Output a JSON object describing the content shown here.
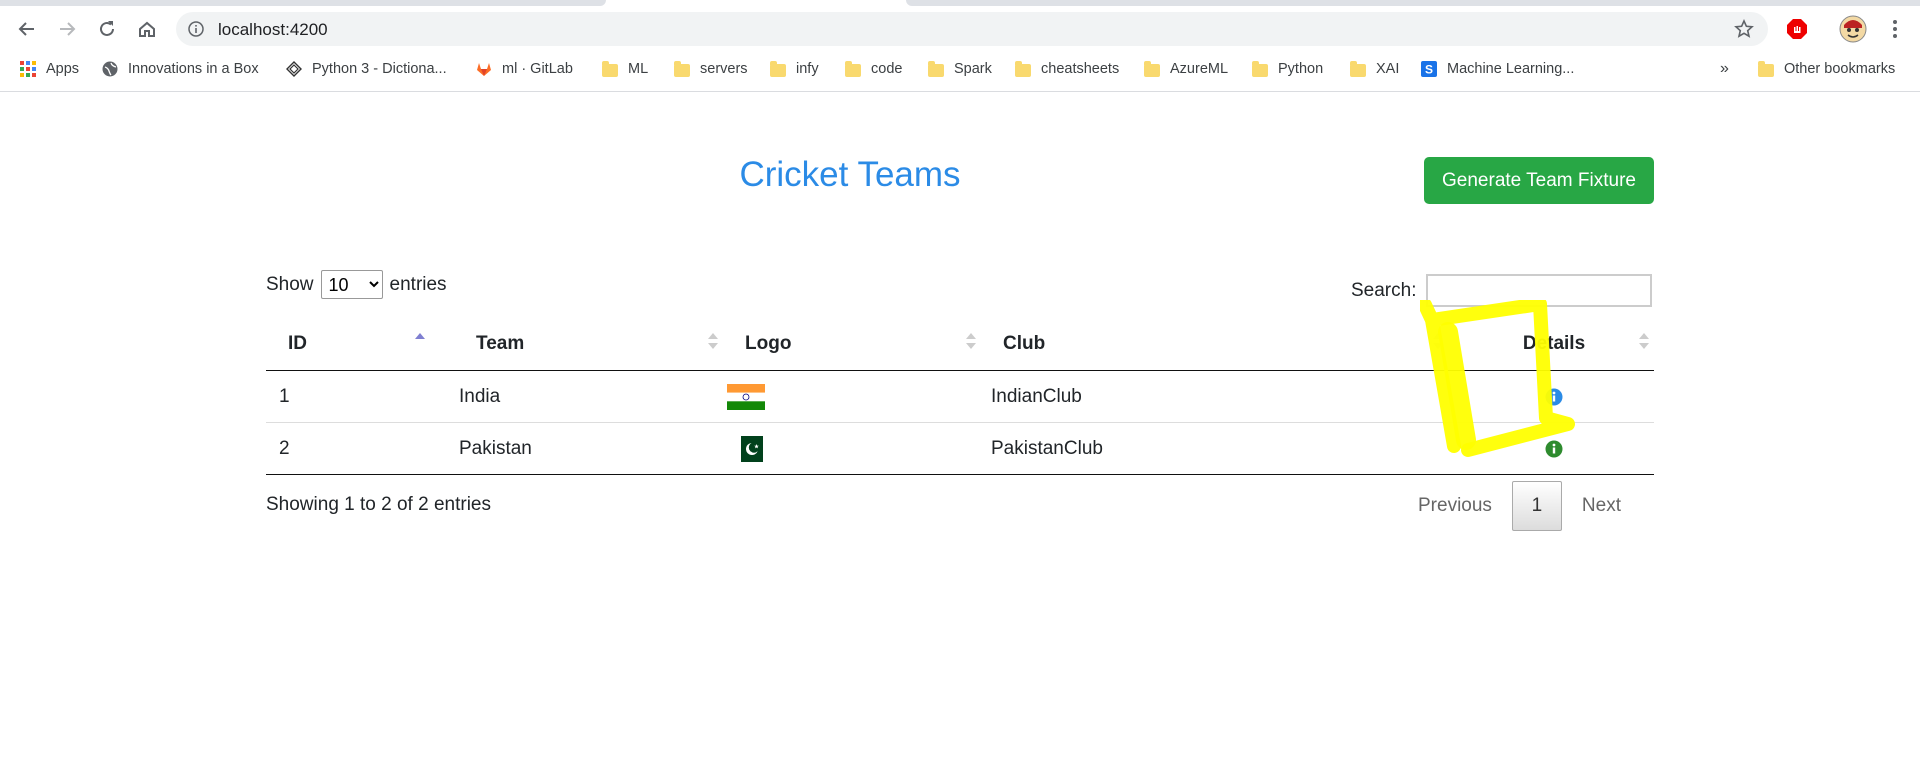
{
  "browser": {
    "url": "localhost:4200",
    "bookmarks": [
      {
        "label": "Apps",
        "icon": "apps-grid-icon"
      },
      {
        "label": "Innovations in a Box",
        "icon": "globe-icon"
      },
      {
        "label": "Python 3 - Dictiona...",
        "icon": "python-diamond-icon"
      },
      {
        "label": "ml · GitLab",
        "icon": "gitlab-icon"
      },
      {
        "label": "ML",
        "icon": "folder-icon"
      },
      {
        "label": "servers",
        "icon": "folder-icon"
      },
      {
        "label": "infy",
        "icon": "folder-icon"
      },
      {
        "label": "code",
        "icon": "folder-icon"
      },
      {
        "label": "Spark",
        "icon": "folder-icon"
      },
      {
        "label": "cheatsheets",
        "icon": "folder-icon"
      },
      {
        "label": "AzureML",
        "icon": "folder-icon"
      },
      {
        "label": "Python",
        "icon": "folder-icon"
      },
      {
        "label": "XAI",
        "icon": "folder-icon"
      },
      {
        "label": "Machine Learning...",
        "icon": "s-badge-icon"
      }
    ],
    "overflow": "»",
    "other_bookmarks": "Other bookmarks"
  },
  "page": {
    "title": "Cricket Teams",
    "generate_button": "Generate Team Fixture",
    "show_label": "Show",
    "entries_label": "entries",
    "length_selected": "10",
    "search_label": "Search:",
    "search_value": "",
    "columns": [
      "ID",
      "Team",
      "Logo",
      "Club",
      "Details"
    ],
    "rows": [
      {
        "id": "1",
        "team": "India",
        "logo": "india-flag",
        "club": "IndianClub"
      },
      {
        "id": "2",
        "team": "Pakistan",
        "logo": "pakistan-flag",
        "club": "PakistanClub"
      }
    ],
    "info": "Showing 1 to 2 of 2 entries",
    "pager": {
      "previous": "Previous",
      "current": "1",
      "next": "Next"
    }
  },
  "colors": {
    "title": "#2b8be6",
    "button": "#28a745",
    "highlight": "#ffff00",
    "info_icon": "#2b8be6"
  }
}
